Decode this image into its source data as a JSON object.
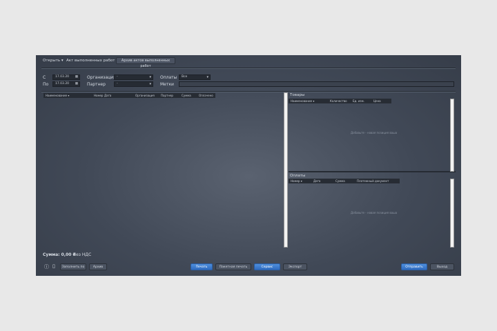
{
  "menu": {
    "open": "Открыть ▾",
    "act": "Акт выполненных работ ▾",
    "archive_tab": "Архив актов выполненных работ"
  },
  "filters": {
    "from_label": "С",
    "from_value": "17.03.20",
    "to_label": "По",
    "to_value": "17.03.20",
    "org_label": "Организация",
    "org_value": "-",
    "partner_label": "Партнер",
    "partner_value": "-",
    "payments_label": "Оплаты",
    "payments_value": "Все",
    "tags_label": "Метки",
    "tags_value": ""
  },
  "acts_table": {
    "columns": [
      "Наименование ▾",
      "Номер",
      "Дата",
      "Организация",
      "Партнер",
      "Сумма",
      "Оплачено"
    ]
  },
  "goods": {
    "title": "Товары",
    "columns": [
      "Наименование ▾",
      "Количество",
      "Ед. изм.",
      "Цена"
    ],
    "placeholder": "Добавьте - новая позиция ваша"
  },
  "payments": {
    "title": "Оплаты",
    "columns": [
      "Номер ▾",
      "Дата",
      "Сумма",
      "Платежный документ"
    ],
    "placeholder": "Добавьте - новая позиция ваша"
  },
  "footer": {
    "sum": "Сумма: 0,00 ₽",
    "vat": "Без НДС",
    "fill_by": "Заполнить по",
    "archive": "Архив",
    "print": "Печать",
    "batch_print": "Пакетная печать",
    "service": "Сервис",
    "export": "Экспорт",
    "send": "Отправить",
    "exit": "Выход"
  },
  "colors": {
    "window": "#414957",
    "accent": "#3a7acc",
    "background": "#e8e8e8"
  }
}
